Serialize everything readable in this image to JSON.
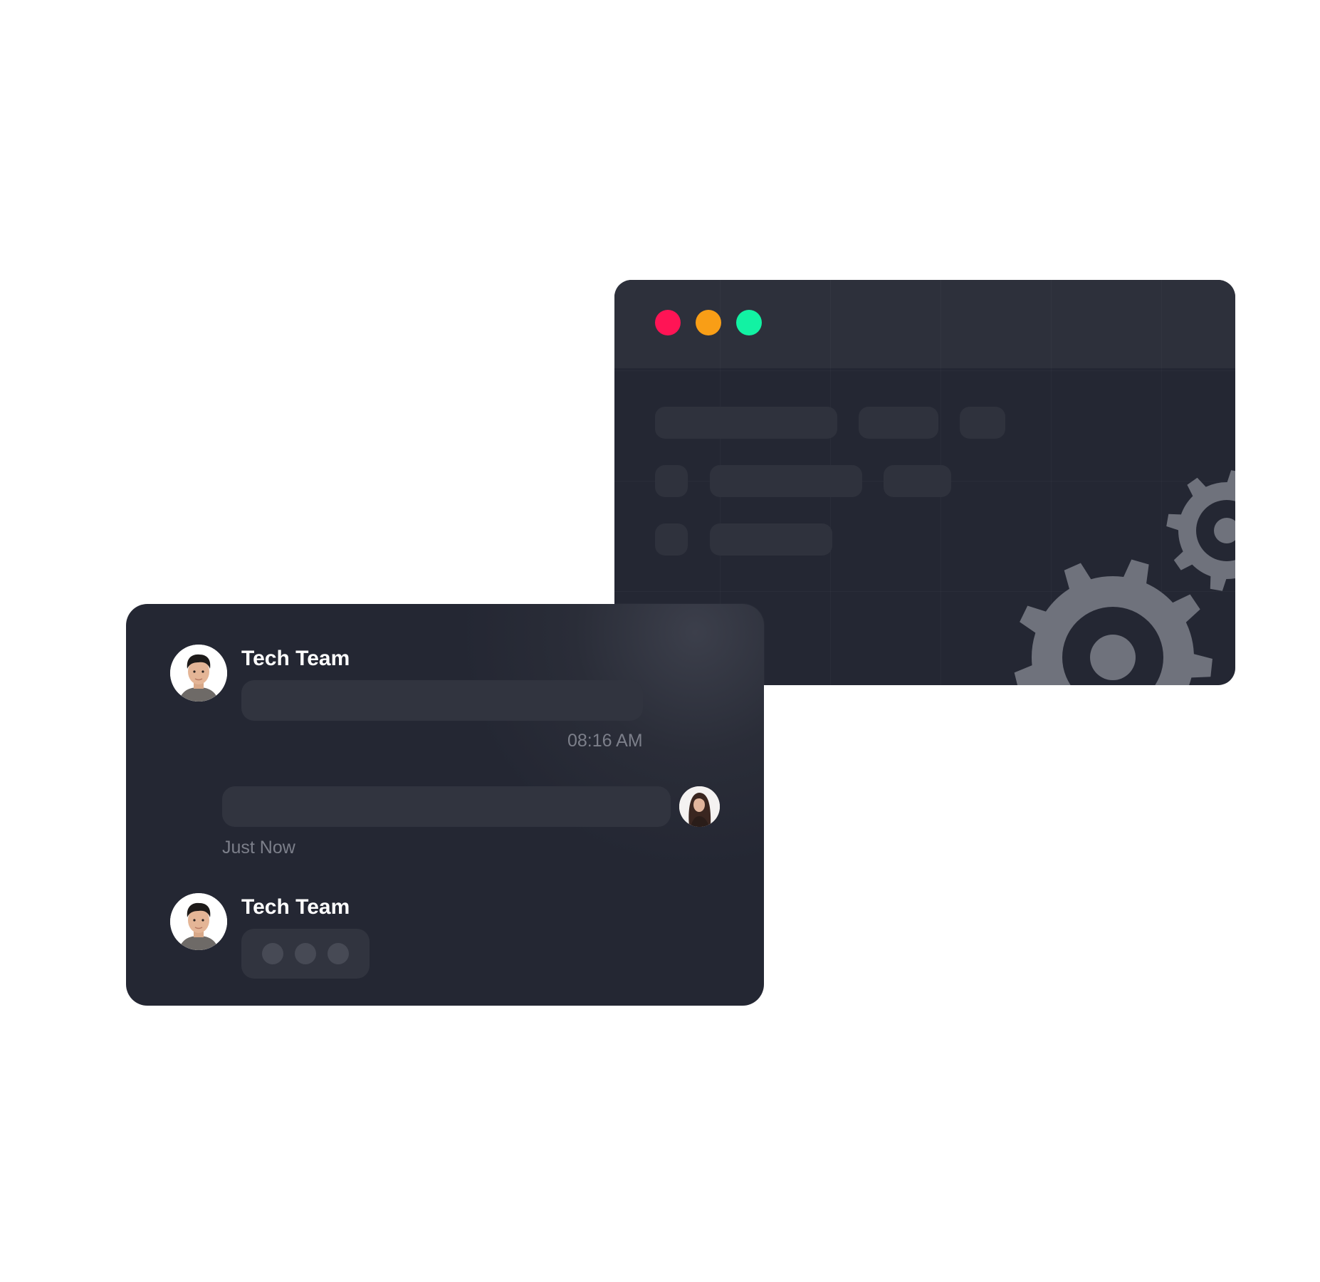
{
  "app_window": {
    "traffic_lights": {
      "close_color": "#ff1455",
      "minimize_color": "#f99e16",
      "maximize_color": "#12f2a3"
    },
    "gear_color": "#6f727c"
  },
  "chat": {
    "messages": [
      {
        "sender": "Tech Team",
        "timestamp": "08:16 AM",
        "direction": "incoming"
      },
      {
        "sender": "",
        "timestamp": "Just Now",
        "direction": "outgoing"
      },
      {
        "sender": "Tech Team",
        "typing": true,
        "direction": "incoming"
      }
    ]
  }
}
